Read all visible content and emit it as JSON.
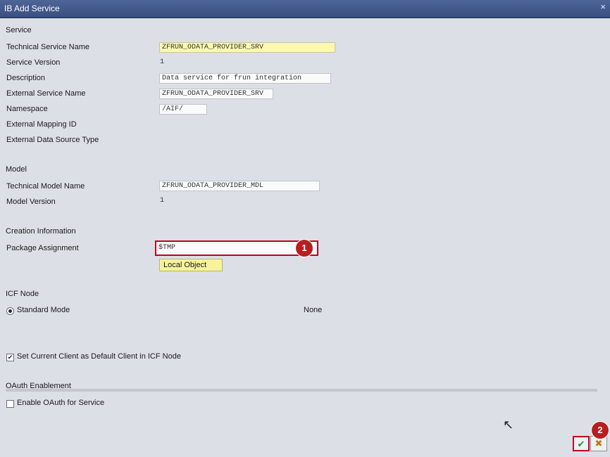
{
  "window": {
    "title": "IB Add Service",
    "close_glyph": "×"
  },
  "service": {
    "section_label": "Service",
    "technical_service_name_label": "Technical Service Name",
    "technical_service_name_value": "ZFRUN_ODATA_PROVIDER_SRV",
    "service_version_label": "Service Version",
    "service_version_value": "1",
    "description_label": "Description",
    "description_value": "Data service for frun integration",
    "external_service_name_label": "External Service Name",
    "external_service_name_value": "ZFRUN_ODATA_PROVIDER_SRV",
    "namespace_label": "Namespace",
    "namespace_value": "/AIF/",
    "external_mapping_id_label": "External Mapping ID",
    "external_data_source_type_label": "External Data Source Type"
  },
  "model": {
    "section_label": "Model",
    "technical_model_name_label": "Technical Model Name",
    "technical_model_name_value": "ZFRUN_ODATA_PROVIDER_MDL",
    "model_version_label": "Model Version",
    "model_version_value": "1"
  },
  "creation": {
    "section_label": "Creation Information",
    "package_assignment_label": "Package Assignment",
    "package_assignment_value": "$TMP",
    "local_object_button": "Local Object"
  },
  "icf": {
    "section_label": "ICF Node",
    "standard_mode_label": "Standard Mode",
    "none_label": "None",
    "set_client_label": "Set Current Client as Default Client in ICF Node"
  },
  "oauth": {
    "section_label": "OAuth Enablement",
    "enable_label": "Enable OAuth for Service"
  },
  "badges": {
    "one": "1",
    "two": "2"
  },
  "footer": {
    "ok_glyph": "✔",
    "cancel_glyph": "✖"
  },
  "colors": {
    "titlebar": "#3a5080",
    "highlight": "#c00022",
    "badge": "#b81e20",
    "yellow_field": "#fbf8b0"
  }
}
